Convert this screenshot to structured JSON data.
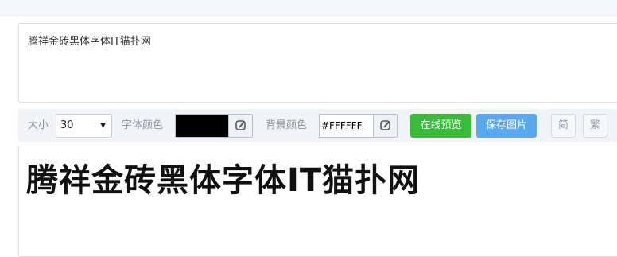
{
  "input": {
    "text": "腾祥金砖黑体字体IT猫扑网"
  },
  "toolbar": {
    "size_label": "大小",
    "size_value": "30",
    "font_color_label": "字体颜色",
    "font_color": "#000000",
    "bg_color_label": "背景颜色",
    "bg_color_value": "#FFFFFF",
    "preview_button": "在线预览",
    "save_button": "保存图片",
    "simplified_button": "简",
    "traditional_button": "繁"
  },
  "preview": {
    "text": "腾祥金砖黑体字体IT猫扑网"
  },
  "colors": {
    "green": "#3cba3c",
    "blue": "#5aa9ee",
    "label": "#8a96a3"
  },
  "icons": [
    "edit-icon"
  ]
}
